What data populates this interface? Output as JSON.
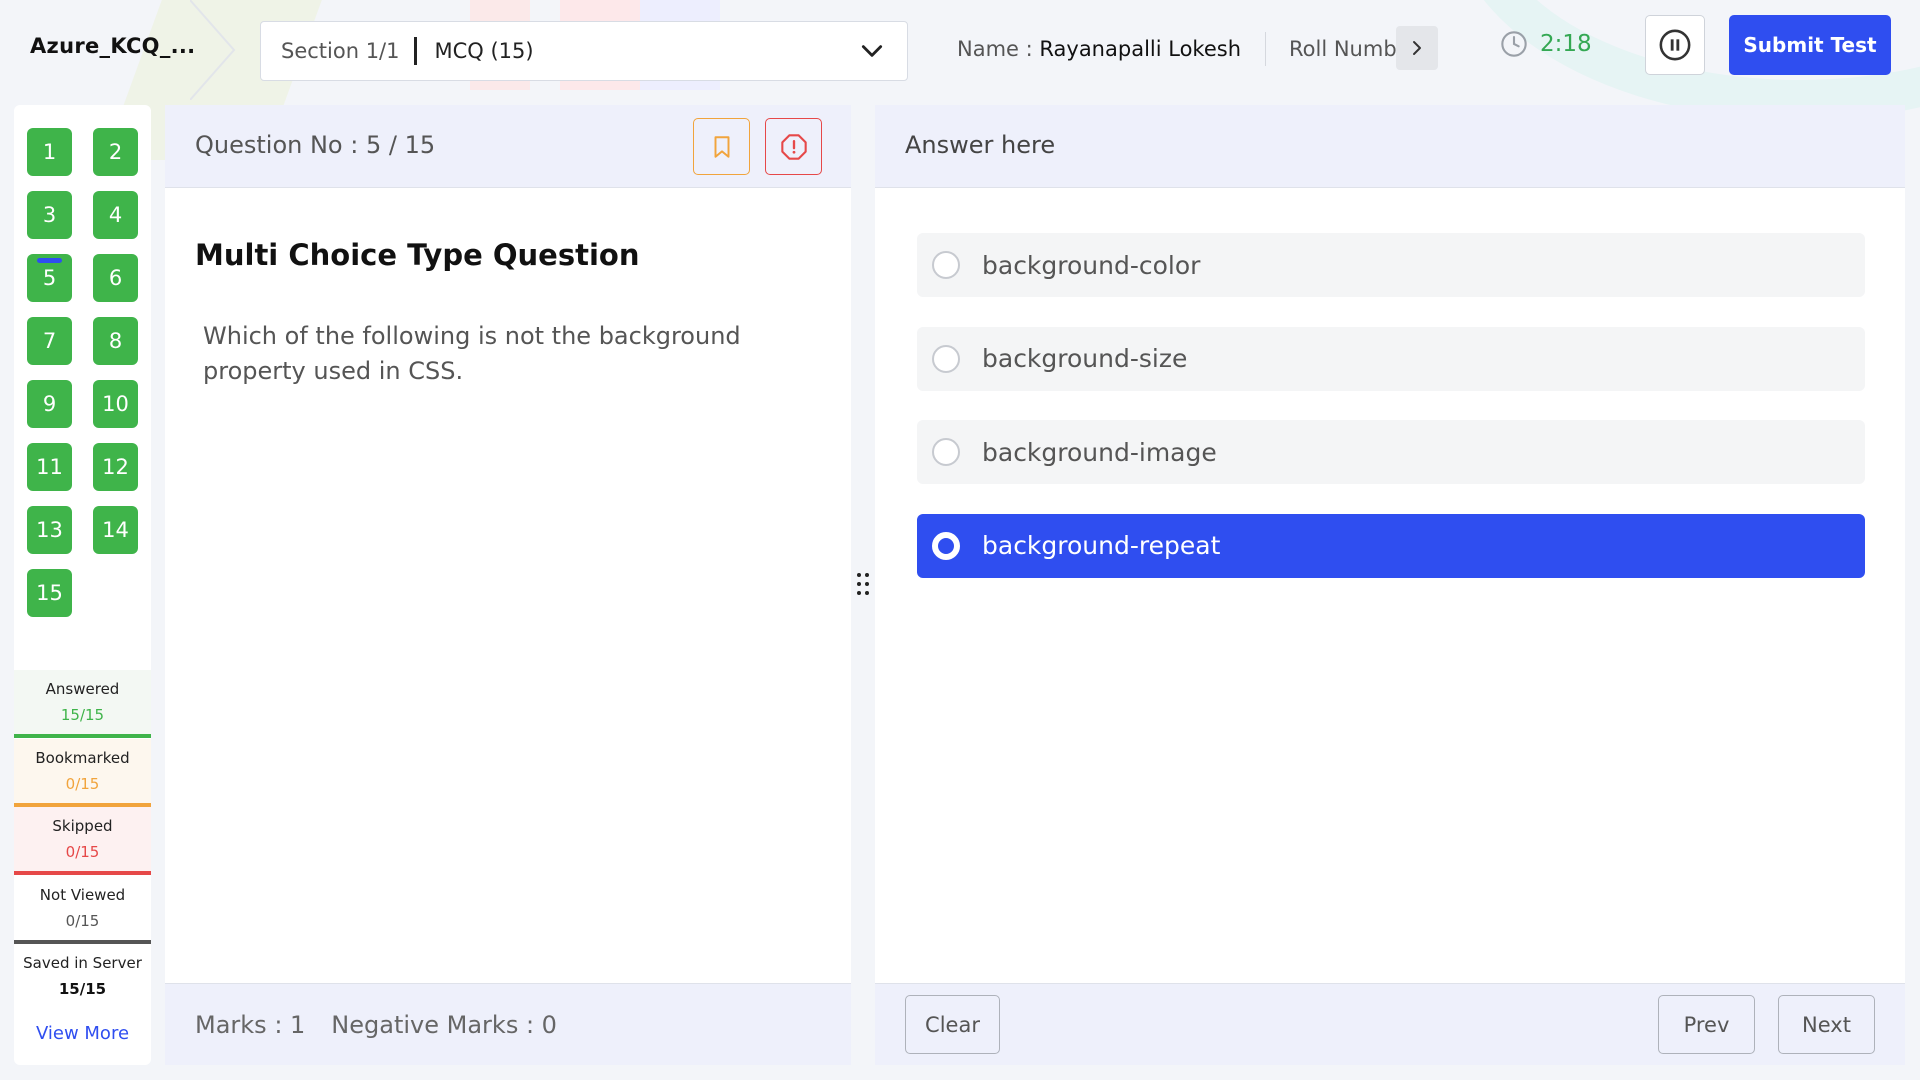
{
  "header": {
    "app_title": "Azure_KCQ_...",
    "section_label": "Section 1/1",
    "section_name": "MCQ (15)",
    "name_label": "Name : ",
    "name_value": "Rayanapalli Lokesh",
    "roll_label": "Roll Numb",
    "timer": "2:18",
    "submit_label": "Submit Test"
  },
  "palette": {
    "questions": [
      "1",
      "2",
      "3",
      "4",
      "5",
      "6",
      "7",
      "8",
      "9",
      "10",
      "11",
      "12",
      "13",
      "14",
      "15"
    ],
    "current": "5",
    "answered_color": "#3fb44a",
    "stats": [
      {
        "label": "Answered",
        "value": "15/15",
        "color": "#3fb44a"
      },
      {
        "label": "Bookmarked",
        "value": "0/15",
        "color": "#f1a43c"
      },
      {
        "label": "Skipped",
        "value": "0/15",
        "color": "#e64848"
      },
      {
        "label": "Not Viewed",
        "value": "0/15",
        "color": "#555555"
      },
      {
        "label": "Saved in Server",
        "value": "15/15",
        "color": "#111111"
      }
    ],
    "view_more": "View More"
  },
  "question": {
    "number_label": "Question No : 5 / 15",
    "type": "Multi Choice Type Question",
    "text": "Which of the following is not the background property used in CSS.",
    "marks": "Marks : 1",
    "negative_marks": "Negative Marks : 0"
  },
  "answer": {
    "title": "Answer here",
    "options": [
      {
        "label": "background-color",
        "selected": false
      },
      {
        "label": "background-size",
        "selected": false
      },
      {
        "label": "background-image",
        "selected": false
      },
      {
        "label": "background-repeat",
        "selected": true
      }
    ],
    "clear_label": "Clear",
    "prev_label": "Prev",
    "next_label": "Next"
  },
  "colors": {
    "accent": "#2f4ef0",
    "timer": "#34a853",
    "bookmark": "#f1a43c",
    "report": "#e64848"
  },
  "icons": {
    "timer": "clock-icon",
    "pause": "pause-icon",
    "bookmark": "bookmark-icon",
    "report": "alert-icon",
    "dropdown": "chevron-down-icon",
    "roll_next": "chevron-right-icon",
    "drag": "drag-handle-icon"
  }
}
